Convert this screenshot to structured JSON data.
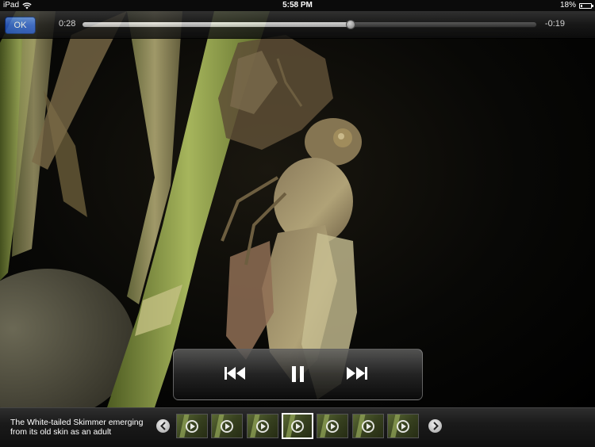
{
  "status_bar": {
    "device": "iPad",
    "time": "5:58 PM",
    "battery_percent": "18%",
    "battery_level": 0.18,
    "wifi_icon": "wifi-icon",
    "battery_icon": "battery-icon"
  },
  "top_bar": {
    "ok_label": "OK",
    "elapsed": "0:28",
    "remaining": "-0:19",
    "progress": 0.59
  },
  "video": {
    "description_subject": "dragonfly emerging on reed stem"
  },
  "transport": {
    "prev_icon": "skip-back-icon",
    "pause_icon": "pause-icon",
    "next_icon": "skip-forward-icon"
  },
  "bottom_bar": {
    "caption_line1": "The White-tailed Skimmer emerging",
    "caption_line2": "from its old skin as an adult",
    "prev_icon": "chevron-left-icon",
    "next_icon": "chevron-right-icon",
    "thumbnails": [
      {
        "selected": false
      },
      {
        "selected": false
      },
      {
        "selected": false
      },
      {
        "selected": true
      },
      {
        "selected": false
      },
      {
        "selected": false
      },
      {
        "selected": false
      }
    ]
  },
  "colors": {
    "ok_button": "#2d62d4",
    "background": "#000000"
  }
}
